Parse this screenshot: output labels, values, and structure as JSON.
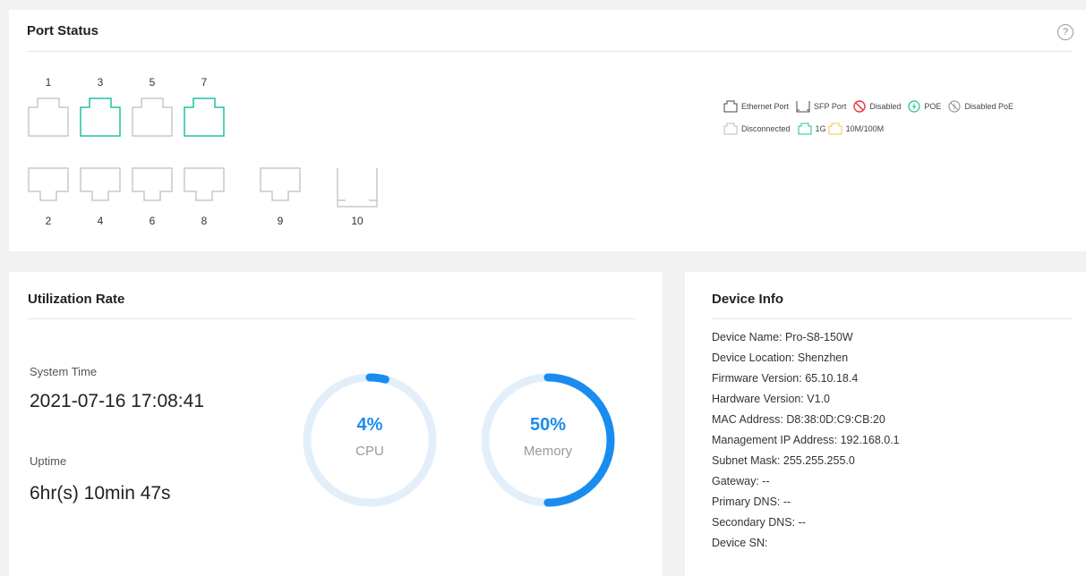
{
  "port_status": {
    "title": "Port Status",
    "help_icon": "?",
    "top_row": [
      {
        "number": "1",
        "state": "disconnected"
      },
      {
        "number": "3",
        "state": "1g"
      },
      {
        "number": "5",
        "state": "disconnected"
      },
      {
        "number": "7",
        "state": "1g"
      }
    ],
    "bottom_row": [
      {
        "number": "2",
        "state": "disconnected"
      },
      {
        "number": "4",
        "state": "disconnected"
      },
      {
        "number": "6",
        "state": "disconnected"
      },
      {
        "number": "8",
        "state": "disconnected"
      },
      {
        "number": "9",
        "state": "disconnected"
      },
      {
        "number": "10",
        "state": "disconnected",
        "type": "sfp"
      }
    ],
    "legend": {
      "ethernet_port": "Ethernet Port",
      "sfp_port": "SFP Port",
      "disabled": "Disabled",
      "poe": "POE",
      "disabled_poe": "Disabled PoE",
      "disconnected": "Disconnected",
      "speed_1g": "1G",
      "speed_10m100m": "10M/100M"
    },
    "colors": {
      "disconnected": "#c8c8c8",
      "speed_1g": "#20c0a0",
      "speed_10m100m": "#f5c64a",
      "disabled": "#e6393e",
      "poe": "#18c08c",
      "disabled_poe": "#999999"
    }
  },
  "utilization": {
    "title": "Utilization Rate",
    "system_time_label": "System Time",
    "system_time": "2021-07-16 17:08:41",
    "uptime_label": "Uptime",
    "uptime": "6hr(s) 10min 47s",
    "cpu": {
      "percent_text": "4%",
      "label": "CPU",
      "value": 4
    },
    "memory": {
      "percent_text": "50%",
      "label": "Memory",
      "value": 50
    },
    "colors": {
      "track": "#e2effb",
      "fill": "#1a8cf0"
    }
  },
  "device_info": {
    "title": "Device Info",
    "lines": [
      "Device Name: Pro-S8-150W",
      "Device Location: Shenzhen",
      "Firmware Version: 65.10.18.4",
      "Hardware Version: V1.0",
      "MAC Address: D8:38:0D:C9:CB:20",
      "Management IP Address: 192.168.0.1",
      "Subnet Mask: 255.255.255.0",
      "Gateway: --",
      "Primary DNS: --",
      "Secondary DNS: --",
      "Device SN:"
    ]
  }
}
